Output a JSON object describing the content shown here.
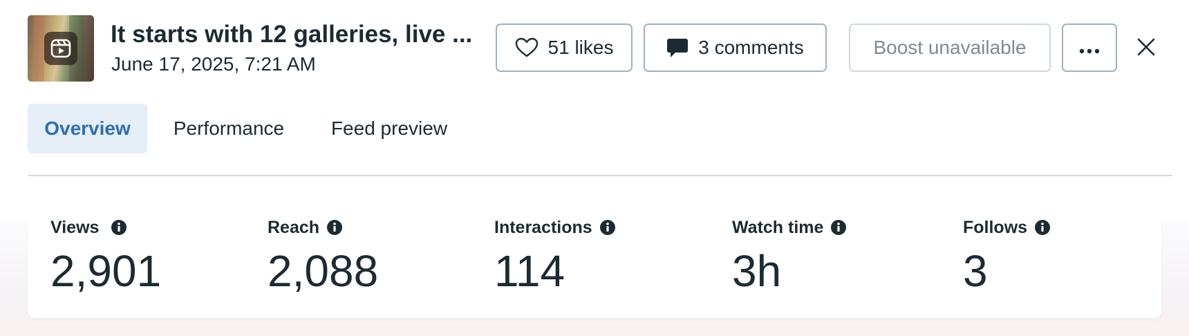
{
  "post": {
    "thumbnail_icon": "reels-icon",
    "title": "It starts with 12 galleries, live ...",
    "date": "June 17, 2025, 7:21 AM"
  },
  "actions": {
    "likes_label": "51 likes",
    "likes_icon": "heart-icon",
    "comments_label": "3 comments",
    "comments_icon": "comment-bubble-icon",
    "boost_label": "Boost unavailable",
    "more_icon": "more-horizontal-icon",
    "close_icon": "close-icon"
  },
  "tabs": [
    {
      "label": "Overview",
      "active": true
    },
    {
      "label": "Performance",
      "active": false
    },
    {
      "label": "Feed preview",
      "active": false
    }
  ],
  "stats": [
    {
      "label": "Views",
      "value": "2,901",
      "icon": "info-icon"
    },
    {
      "label": "Reach",
      "value": "2,088",
      "icon": "info-icon"
    },
    {
      "label": "Interactions",
      "value": "114",
      "icon": "info-icon"
    },
    {
      "label": "Watch time",
      "value": "3h",
      "icon": "info-icon"
    },
    {
      "label": "Follows",
      "value": "3",
      "icon": "info-icon"
    }
  ],
  "colors": {
    "text": "#1c2b33",
    "active_tab_bg": "#e5eef7",
    "active_tab_text": "#2f6db3",
    "button_border": "#9fb1c3",
    "disabled_text": "#7e8a94"
  }
}
